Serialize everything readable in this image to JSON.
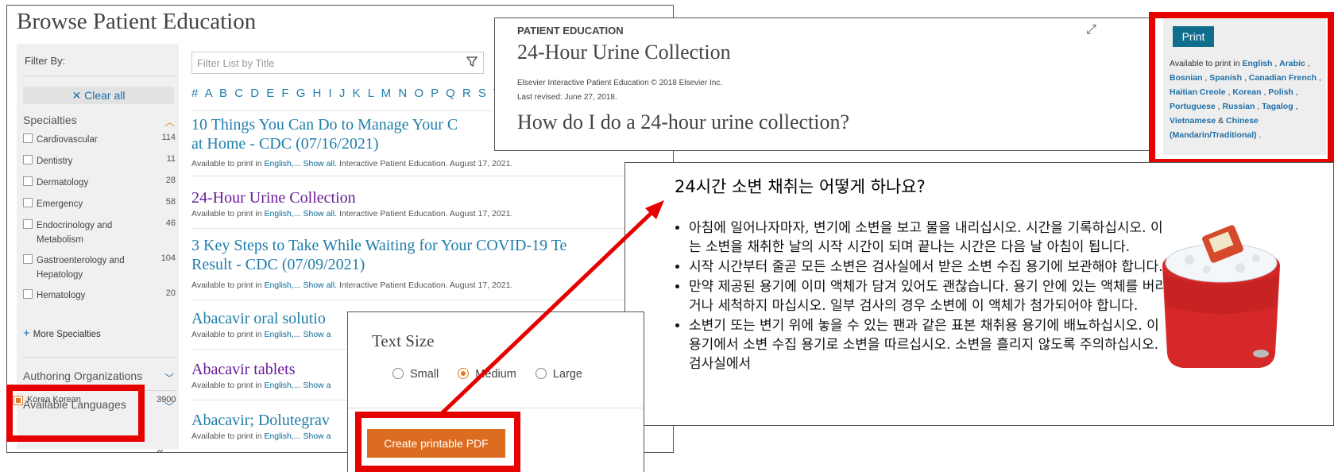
{
  "browse": {
    "title": "Browse Patient Education",
    "filter_by": "Filter By:",
    "clear_all": "Clear all",
    "specialties_heading": "Specialties",
    "specialties": [
      {
        "name": "Cardiovascular",
        "count": "114"
      },
      {
        "name": "Dentistry",
        "count": "11"
      },
      {
        "name": "Dermatology",
        "count": "28"
      },
      {
        "name": "Emergency",
        "count": "58"
      },
      {
        "name": "Endocrinology and Metabolism",
        "count": "46"
      },
      {
        "name": "Gastroenterology and Hepatology",
        "count": "104"
      },
      {
        "name": "Hematology",
        "count": "20"
      }
    ],
    "more_specialties": "More Specialties",
    "authoring_orgs": "Authoring Organizations",
    "available_languages": "Available Languages",
    "language_option": {
      "name": "Korea Korean",
      "count": "3900"
    },
    "filter_placeholder": "Filter List by Title",
    "alphabet": "# A B C D E F G H I J K L M N O P Q R S T",
    "articles": [
      {
        "title_lines": [
          "10 Things You Can Do to Manage Your C",
          "at Home - CDC (07/16/2021)"
        ],
        "meta_prefix": "Available to print in ",
        "meta_lang": "English,...",
        "meta_show": "Show all.",
        "meta_suffix": " Interactive Patient Education. August 17, 2021.",
        "color": "#1f7eaa"
      },
      {
        "title_lines": [
          "24-Hour Urine Collection"
        ],
        "meta_prefix": "Available to print in ",
        "meta_lang": "English,...",
        "meta_show": "Show all.",
        "meta_suffix": " Interactive Patient Education. August 17, 2021.",
        "color": "#6a1b9a"
      },
      {
        "title_lines": [
          "3 Key Steps to Take While Waiting for Your COVID-19 Te",
          "Result - CDC (07/09/2021)"
        ],
        "meta_prefix": "Available to print in ",
        "meta_lang": "English,...",
        "meta_show": "Show all.",
        "meta_suffix": " Interactive Patient Education. August 17, 2021.",
        "color": "#1f7eaa"
      },
      {
        "title_lines": [
          "Abacavir oral solutio"
        ],
        "meta_prefix": "Available to print in ",
        "meta_lang": "English,...",
        "meta_show": "Show a",
        "meta_suffix": "",
        "color": "#1f7eaa"
      },
      {
        "title_lines": [
          "Abacavir tablets"
        ],
        "meta_prefix": "Available to print in ",
        "meta_lang": "English,...",
        "meta_show": "Show a",
        "meta_suffix": "",
        "color": "#6a1b9a"
      },
      {
        "title_lines": [
          "Abacavir; Dolutegrav"
        ],
        "meta_prefix": "Available to print in ",
        "meta_lang": "English,...",
        "meta_show": "Show a",
        "meta_suffix": "",
        "color": "#1f7eaa"
      }
    ]
  },
  "article": {
    "label": "PATIENT EDUCATION",
    "title": "24-Hour Urine Collection",
    "copyright": "Elsevier Interactive Patient Education © 2018 Elsevier Inc.",
    "revised": "Last revised: June 27, 2018.",
    "question": "How do I do a 24-hour urine collection?"
  },
  "print": {
    "button": "Print",
    "available_prefix": "Available to print in ",
    "languages": [
      "English",
      "Arabic",
      "Bosnian",
      "Spanish",
      "Canadian French",
      "Haitian Creole",
      "Korean",
      "Polish",
      "Portuguese",
      "Russian",
      "Tagalog",
      "Vietnamese"
    ],
    "last_language": "Chinese (Mandarin/Traditional)",
    "and_word": "&"
  },
  "korean": {
    "title": "24시간 소변 채취는 어떻게 하나요?",
    "bullets": [
      "아침에 일어나자마자, 변기에 소변을 보고 물을 내리십시오. 시간을 기록하십시오. 이는 소변을 채취한 날의 시작 시간이 되며 끝나는 시간은 다음 날 아침이 됩니다.",
      "시작 시간부터 줄곧 모든 소변은 검사실에서 받은 소변 수집 용기에 보관해야 합니다.",
      "만약 제공된 용기에 이미 액체가 담겨 있어도 괜찮습니다. 용기 안에 있는 액체를 버리거나 세척하지 마십시오. 일부 검사의 경우 소변에 이 액체가 첨가되어야 합니다.",
      "소변기 또는 변기 위에 놓을 수 있는 팬과 같은 표본 채취용 용기에 배뇨하십시오. 이 용기에서 소변 수집 용기로 소변을 따르십시오. 소변을 흘리지 않도록 주의하십시오. 검사실에서"
    ]
  },
  "text_size": {
    "title": "Text Size",
    "options": [
      "Small",
      "Medium",
      "Large"
    ],
    "selected": "Medium",
    "pdf_button": "Create printable PDF"
  },
  "colors": {
    "highlight": "#e60000",
    "accent_orange": "#dc6d20",
    "link_teal": "#1f7eaa",
    "print_blue": "#0f6e8c"
  }
}
